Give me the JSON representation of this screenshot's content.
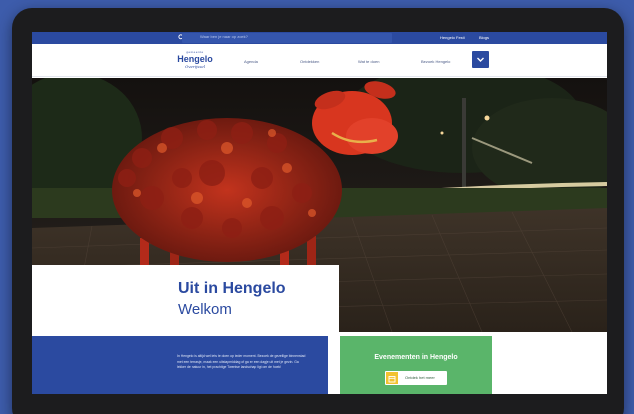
{
  "topbar": {
    "search_placeholder": "Waar ben je naar op zoek?",
    "links": [
      "Hengelo Festi",
      "Blogs"
    ]
  },
  "logo": {
    "top_text": "gemeente",
    "name": "Hengelo",
    "tagline": "Overijssel"
  },
  "nav": {
    "items": [
      "Agenda",
      "Ontdekken",
      "Wat te doen",
      "Bezoek Hengelo"
    ],
    "toggle_icon": "chevron-down-icon"
  },
  "hero": {
    "title": "Uit in Hengelo",
    "subtitle": "Welkom"
  },
  "intro": {
    "text": "In Hengelo is altijd wel iets te doen op ieder moment. Bezoek de gezellige binnenstad met een terrasje, maak een uitstapmiddag of ga er een dagje uit met je gezin. Ga lekker de natuur in, het prachtige Twentse landschap ligt om de hoek!"
  },
  "events": {
    "title": "Evenementen in Hengelo",
    "button_label": "Ontdek het meer",
    "button_icon": "calendar-icon"
  },
  "colors": {
    "brand_blue": "#2b4aa0",
    "background": "#3d5cab",
    "events_green": "#5ab56a",
    "accent_yellow": "#f2c230"
  }
}
